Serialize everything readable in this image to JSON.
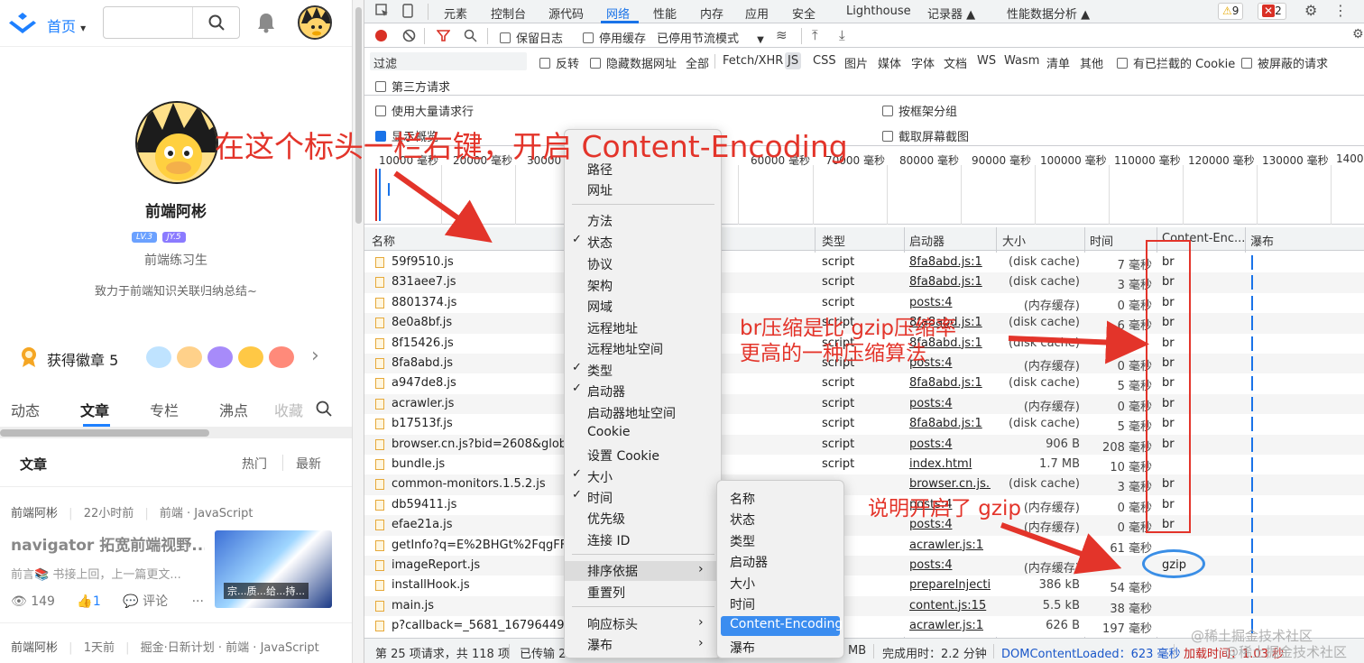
{
  "left": {
    "nav": {
      "home": "首页",
      "home_arrow": "▾",
      "search_placeholder": "",
      "search_icon": "search-icon",
      "bell_icon": "bell-icon"
    },
    "profile": {
      "name": "前端阿彬",
      "lv": "LV.3",
      "jy": "JY.5",
      "title": "前端练习生",
      "desc": "致力于前端知识关联归纳总结~"
    },
    "badges": {
      "label": "获得徽章 5",
      "arrow": "›"
    },
    "tabs": [
      "动态",
      "文章",
      "专栏",
      "沸点",
      "收藏"
    ],
    "article_header": {
      "title": "文章",
      "hot": "热门",
      "new": "最新"
    },
    "article": {
      "author": "前端阿彬",
      "time": "22小时前",
      "tags": "前端 · JavaScript",
      "title": "navigator 拓宽前端视野...",
      "summary": "前言📚 书接上回，上一篇更文...",
      "thumb_caption": "宗...质...给...持...",
      "views": "149",
      "likes": "1",
      "comment": "评论",
      "more": "···"
    },
    "article2": {
      "author": "前端阿彬",
      "time": "1天前",
      "tags": "掘金·日新计划 · 前端 · JavaScript"
    }
  },
  "devtools": {
    "tabs": [
      "元素",
      "控制台",
      "源代码",
      "网络",
      "性能",
      "内存",
      "应用",
      "安全",
      "Lighthouse",
      "记录器 ▲",
      "性能数据分析 ▲"
    ],
    "warnings": "9",
    "errors": "2",
    "toolbar": {
      "preserve_log": "保留日志",
      "disable_cache": "停用缓存",
      "throttle": "已停用节流模式",
      "throttle_arrow": "▼"
    },
    "filter": {
      "placeholder": "过滤",
      "invert": "反转",
      "hide_data": "隐藏数据网址",
      "all": "全部",
      "types": [
        "Fetch/XHR",
        "JS",
        "CSS",
        "图片",
        "媒体",
        "字体",
        "文档",
        "WS",
        "Wasm",
        "清单",
        "其他"
      ],
      "blocked_cookie": "有已拦截的 Cookie",
      "blocked_req": "被屏蔽的请求",
      "third_party": "第三方请求"
    },
    "options": {
      "large_rows": "使用大量请求行",
      "overview": "显示概览",
      "group_frame": "按框架分组",
      "screenshot": "截取屏幕截图"
    },
    "ticks": [
      "10000 毫秒",
      "20000 毫秒",
      "30000 毫秒",
      "60000 毫秒",
      "70000 毫秒",
      "80000 毫秒",
      "90000 毫秒",
      "100000 毫秒",
      "110000 毫秒",
      "120000 毫秒",
      "130000 毫秒",
      "14000"
    ],
    "columns": {
      "name": "名称",
      "type": "类型",
      "initiator": "启动器",
      "size": "大小",
      "time": "时间",
      "encoding": "Content-Enc...",
      "waterfall": "瀑布"
    },
    "rows": [
      {
        "name": "59f9510.js",
        "type": "script",
        "init": "8fa8abd.js:1",
        "size": "(disk cache)",
        "time": "7 毫秒",
        "enc": "br"
      },
      {
        "name": "831aee7.js",
        "type": "script",
        "init": "8fa8abd.js:1",
        "size": "(disk cache)",
        "time": "3 毫秒",
        "enc": "br"
      },
      {
        "name": "8801374.js",
        "type": "script",
        "init": "posts:4",
        "size": "(内存缓存)",
        "time": "0 毫秒",
        "enc": "br"
      },
      {
        "name": "8e0a8bf.js",
        "type": "script",
        "init": "8fa8abd.js:1",
        "size": "(disk cache)",
        "time": "6 毫秒",
        "enc": "br"
      },
      {
        "name": "8f15426.js",
        "type": "script",
        "init": "8fa8abd.js:1",
        "size": "(disk cache)",
        "time": "",
        "enc": "br"
      },
      {
        "name": "8fa8abd.js",
        "type": "script",
        "init": "posts:4",
        "size": "(内存缓存)",
        "time": "0 毫秒",
        "enc": "br"
      },
      {
        "name": "a947de8.js",
        "type": "script",
        "init": "8fa8abd.js:1",
        "size": "(disk cache)",
        "time": "5 毫秒",
        "enc": "br"
      },
      {
        "name": "acrawler.js",
        "type": "script",
        "init": "posts:4",
        "size": "(内存缓存)",
        "time": "0 毫秒",
        "enc": "br"
      },
      {
        "name": "b17513f.js",
        "type": "script",
        "init": "8fa8abd.js:1",
        "size": "(disk cache)",
        "time": "5 毫秒",
        "enc": "br"
      },
      {
        "name": "browser.cn.js?bid=2608&globalNa",
        "type": "script",
        "init": "posts:4",
        "size": "906 B",
        "time": "208 毫秒",
        "enc": "br"
      },
      {
        "name": "bundle.js",
        "type": "script",
        "init": "index.html",
        "size": "1.7 MB",
        "time": "10 毫秒",
        "enc": ""
      },
      {
        "name": "common-monitors.1.5.2.js",
        "type": "",
        "init": "browser.cn.js...",
        "size": "(disk cache)",
        "time": "3 毫秒",
        "enc": "br"
      },
      {
        "name": "db59411.js",
        "type": "",
        "init": "posts:4",
        "size": "(内存缓存)",
        "time": "0 毫秒",
        "enc": "br"
      },
      {
        "name": "efae21a.js",
        "type": "",
        "init": "posts:4",
        "size": "(内存缓存)",
        "time": "0 毫秒",
        "enc": "br"
      },
      {
        "name": "getInfo?q=E%2BHGt%2FqgFFnX",
        "type": "",
        "init": "acrawler.js:1",
        "size": "",
        "time": "61 毫秒",
        "enc": ""
      },
      {
        "name": "imageReport.js",
        "type": "",
        "init": "posts:4",
        "size": "(内存缓存)",
        "time": "",
        "enc": "gzip"
      },
      {
        "name": "installHook.js",
        "type": "",
        "init": "prepareInjecti...",
        "size": "386 kB",
        "time": "54 毫秒",
        "enc": ""
      },
      {
        "name": "main.js",
        "type": "",
        "init": "content.js:15",
        "size": "5.5 kB",
        "time": "38 毫秒",
        "enc": ""
      },
      {
        "name": "p?callback=_5681_1679644905",
        "type": "",
        "init": "acrawler.js:1",
        "size": "626 B",
        "time": "197 毫秒",
        "enc": ""
      }
    ],
    "status": {
      "requests": "第 25 项请求，共 118 项",
      "transferred": "已传输 2",
      "mb": "MB",
      "finish": "完成用时：2.2 分钟",
      "dcl": "DOMContentLoaded：623 毫秒",
      "load": "加载时间：1.03 秒"
    }
  },
  "context_menu": {
    "items": [
      {
        "label": "路径",
        "checked": false
      },
      {
        "label": "网址",
        "checked": false
      },
      {
        "label": "方法",
        "checked": false
      },
      {
        "label": "状态",
        "checked": true
      },
      {
        "label": "协议",
        "checked": false
      },
      {
        "label": "架构",
        "checked": false
      },
      {
        "label": "网域",
        "checked": false
      },
      {
        "label": "远程地址",
        "checked": false
      },
      {
        "label": "远程地址空间",
        "checked": false
      },
      {
        "label": "类型",
        "checked": true
      },
      {
        "label": "启动器",
        "checked": true
      },
      {
        "label": "启动器地址空间",
        "checked": false
      },
      {
        "label": "Cookie",
        "checked": false
      },
      {
        "label": "设置 Cookie",
        "checked": false
      },
      {
        "label": "大小",
        "checked": true
      },
      {
        "label": "时间",
        "checked": true
      },
      {
        "label": "优先级",
        "checked": false
      },
      {
        "label": "连接 ID",
        "checked": false
      },
      {
        "label": "排序依据",
        "checked": false
      },
      {
        "label": "重置列",
        "checked": false
      },
      {
        "label": "响应标头",
        "checked": false
      },
      {
        "label": "瀑布",
        "checked": false
      }
    ],
    "check": "✓",
    "arrow": "›"
  },
  "submenu": {
    "items": [
      "名称",
      "状态",
      "类型",
      "启动器",
      "大小",
      "时间",
      "Content-Encoding",
      "瀑布"
    ]
  },
  "annotations": {
    "top": "在这个标头一栏右键，开启 Content-Encoding",
    "br1": "br压缩是比 gzip压缩率",
    "br2": "更高的一种压缩算法",
    "gzip": "说明开启了 gzip"
  },
  "watermark": "@稀土掘金技术社区",
  "colors": {
    "accent": "#1a73e8",
    "annotation": "#e3342a",
    "juejin": "#1e80ff",
    "circle": "#3a8ee6"
  }
}
